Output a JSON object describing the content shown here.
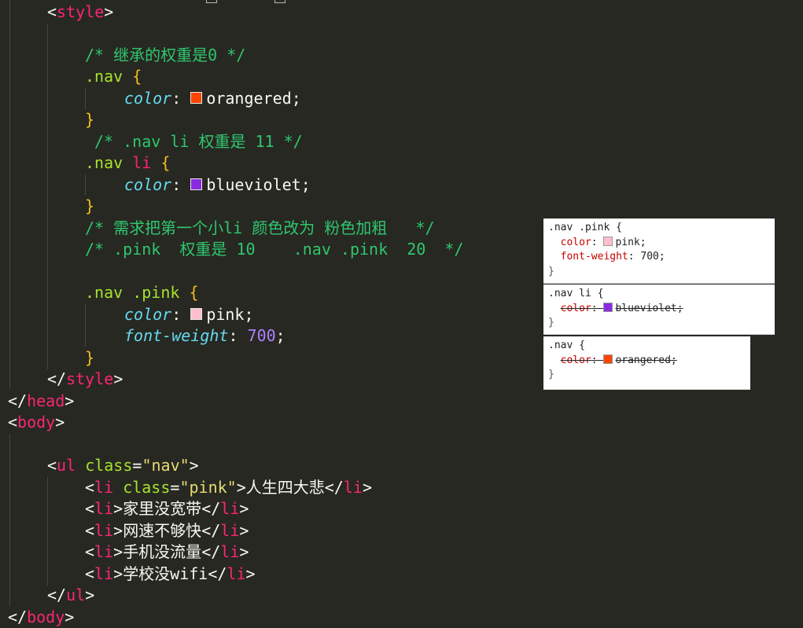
{
  "colors": {
    "background": "#272822",
    "comment": "#2fc66d",
    "tag": "#f92672",
    "attr": "#a6e22e",
    "string": "#e6db74",
    "brace": "#f4bf1d",
    "property": "#66d9ef",
    "number": "#ae81ff",
    "orangered": "#ff4500",
    "blueviolet": "#8a2be2",
    "pink": "#ffc0cb"
  },
  "code": {
    "style_open": "style",
    "comment1": "/* 继承的权重是0 */",
    "sel_nav": ".nav",
    "brace_open": "{",
    "brace_close": "}",
    "prop_color": "color",
    "colon": ":",
    "semicolon": ";",
    "val_orangered": "orangered",
    "comment2": "/* .nav li 权重是 11 */",
    "sel_nav_li_1": ".nav",
    "sel_nav_li_2": "li",
    "val_blueviolet": "blueviolet",
    "comment3": "/* 需求把第一个小li 颜色改为 粉色加粗   */",
    "comment4": "/* .pink  权重是 10    .nav .pink  20  */",
    "sel_nav_pink_1": ".nav",
    "sel_nav_pink_2": ".pink",
    "val_pink": "pink",
    "prop_font_weight": "font-weight",
    "val_700": "700",
    "style_close": "style",
    "head_close": "head",
    "body_open": "body",
    "ul": "ul",
    "class_attr": "class",
    "ul_class_val": "\"nav\"",
    "li": "li",
    "li_class_val": "\"pink\"",
    "li_items": [
      "人生四大悲",
      "家里没宽带",
      "网速不够快",
      "手机没流量",
      "学校没wifi"
    ],
    "body_close": "body"
  },
  "devtools": {
    "rule1": {
      "selector": ".nav .pink {",
      "prop1": "color",
      "val1": "pink;",
      "prop2": "font-weight",
      "val2": "700;",
      "close": "}"
    },
    "rule2": {
      "selector": ".nav li {",
      "prop1": "color",
      "val1": "blueviolet;",
      "close": "}"
    },
    "rule3": {
      "selector": ".nav {",
      "prop1": "color",
      "val1": "orangered;",
      "close": "}"
    }
  }
}
